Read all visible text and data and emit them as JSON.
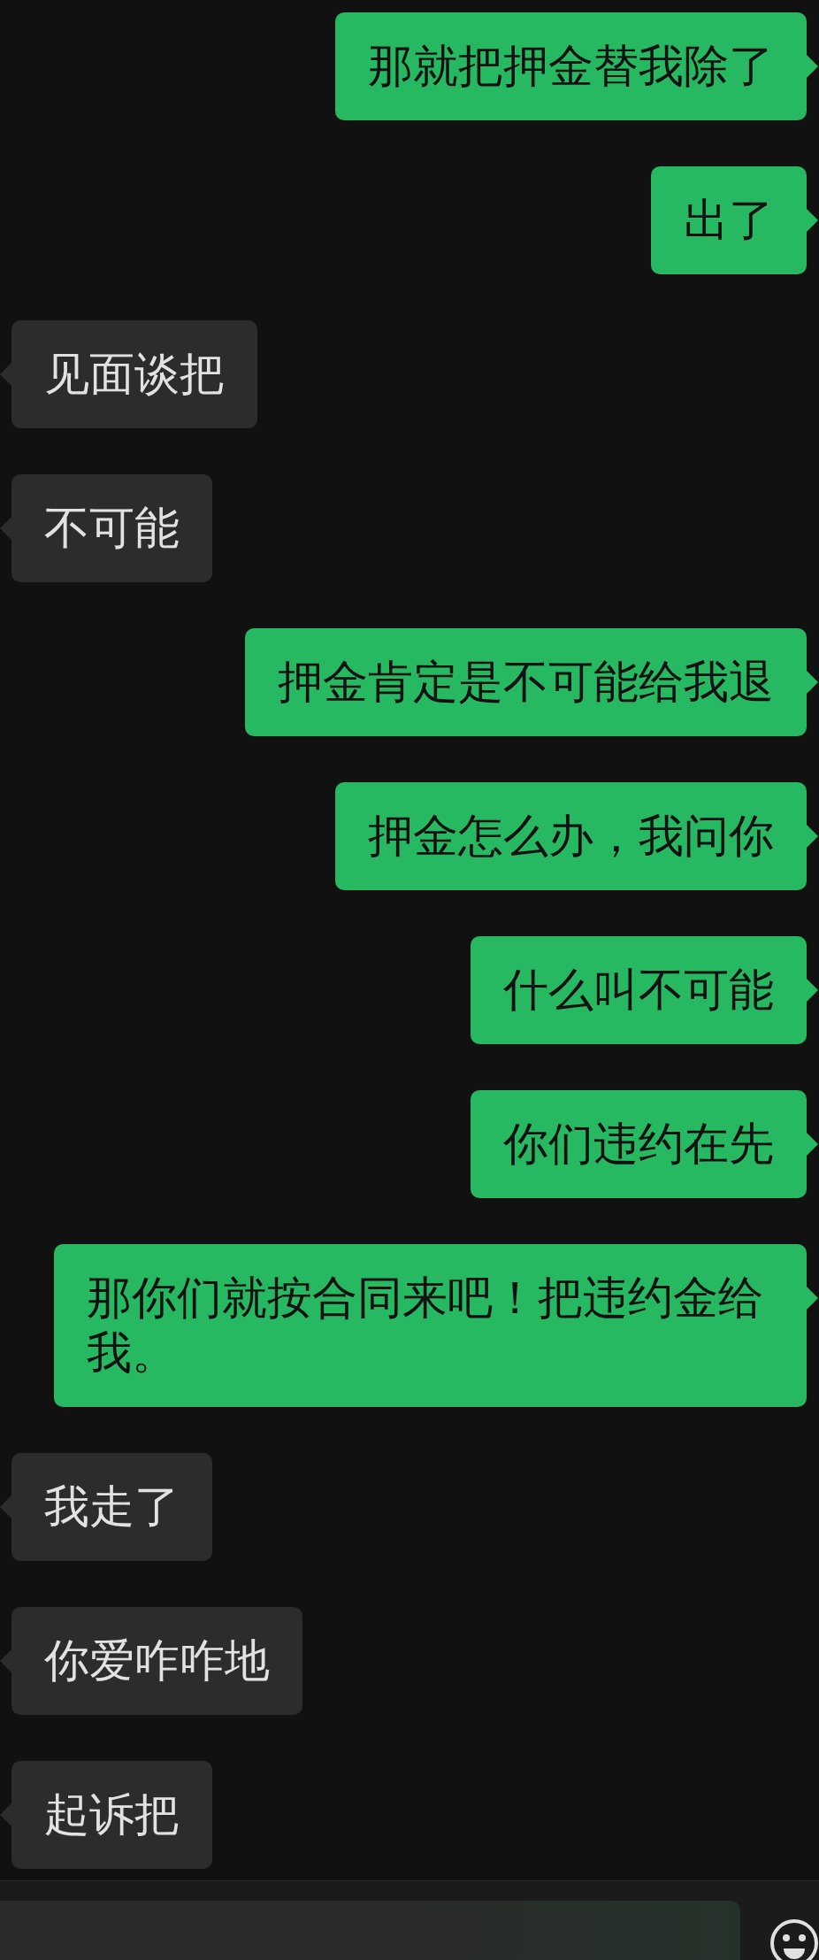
{
  "messages": [
    {
      "kind": "sent",
      "text": "那就把押金替我除了"
    },
    {
      "kind": "sent",
      "text": "出了"
    },
    {
      "kind": "received",
      "text": "见面谈把"
    },
    {
      "kind": "received",
      "text": "不可能"
    },
    {
      "kind": "sent",
      "text": "押金肯定是不可能给我退"
    },
    {
      "kind": "sent",
      "text": "押金怎么办，我问你"
    },
    {
      "kind": "sent",
      "text": "什么叫不可能"
    },
    {
      "kind": "sent",
      "text": "你们违约在先"
    },
    {
      "kind": "sent",
      "text": "那你们就按合同来吧！把违约金给我。"
    },
    {
      "kind": "received",
      "text": "我走了"
    },
    {
      "kind": "received",
      "text": "你爱咋咋地"
    },
    {
      "kind": "received",
      "text": "起诉把"
    }
  ]
}
